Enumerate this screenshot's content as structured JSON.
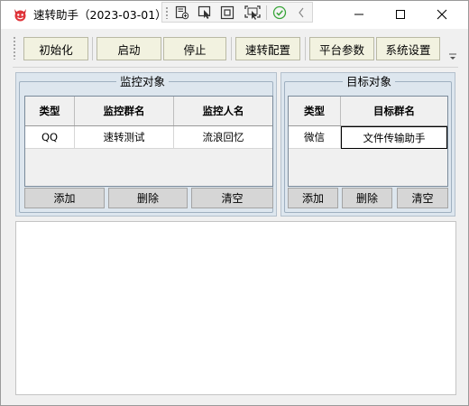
{
  "window": {
    "title": "速转助手（2023-03-01）",
    "app_icon": "devil-face-icon",
    "titlebar_tools": [
      "add-frame-icon",
      "pointer-select-icon",
      "frame-icon",
      "screen-select-icon",
      "checkmark-icon",
      "chevron-left-icon"
    ],
    "controls": [
      "minimize-icon",
      "maximize-icon",
      "close-icon"
    ]
  },
  "toolbar": {
    "buttons": [
      "初始化",
      "启动",
      "停止",
      "速转配置",
      "平台参数",
      "系统设置"
    ],
    "overflow_icon": "chevron-down-icon"
  },
  "monitor_group": {
    "title": "监控对象",
    "columns": [
      "类型",
      "监控群名",
      "监控人名"
    ],
    "rows": [
      [
        "QQ",
        "速转测试",
        "流浪回忆"
      ]
    ],
    "buttons": [
      "添加",
      "删除",
      "清空"
    ]
  },
  "target_group": {
    "title": "目标对象",
    "columns": [
      "类型",
      "目标群名"
    ],
    "rows": [
      [
        "微信",
        "文件传输助手"
      ]
    ],
    "buttons": [
      "添加",
      "删除",
      "清空"
    ]
  },
  "log": {
    "text": ""
  },
  "colors": {
    "toolbar_button_bg": "#f2f2e0",
    "group_bg": "#dde6ee",
    "checkmark": "#3aa53a"
  }
}
